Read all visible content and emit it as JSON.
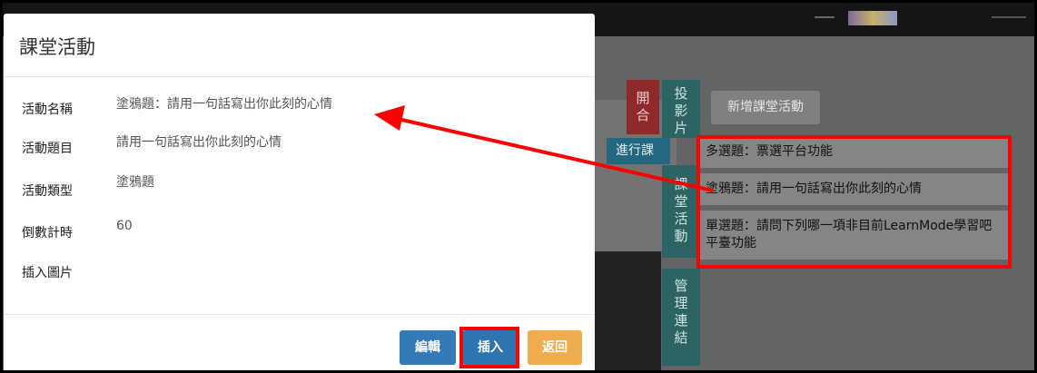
{
  "modal": {
    "title": "課堂活動",
    "fields": [
      {
        "label": "活動名稱",
        "value": "塗鴉題：請用一句話寫出你此刻的心情"
      },
      {
        "label": "活動題目",
        "value": "請用一句話寫出你此刻的心情"
      },
      {
        "label": "活動類型",
        "value": "塗鴉題"
      },
      {
        "label": "倒數計時",
        "value": "60"
      },
      {
        "label": "插入圖片",
        "value": ""
      }
    ],
    "buttons": {
      "edit": "編輯",
      "insert": "插入",
      "back": "返回"
    }
  },
  "background": {
    "open_button": [
      "開",
      "合"
    ],
    "progress_button": "進行課",
    "side_tabs": [
      [
        "投",
        "影",
        "片"
      ],
      [
        "課",
        "堂",
        "活",
        "動"
      ],
      [
        "管",
        "理",
        "連",
        "結"
      ]
    ],
    "add_activity_button": "新增課堂活動",
    "activities": [
      "多選題：票選平台功能",
      "塗鴉題：請用一句話寫出你此刻的心情",
      "單選題：請問下列哪一項非目前LearnMode學習吧平臺功能"
    ]
  },
  "colors": {
    "highlight": "#ff0000",
    "primary": "#337ab7",
    "warning": "#f0ad4e",
    "teal": "#2c6363"
  }
}
